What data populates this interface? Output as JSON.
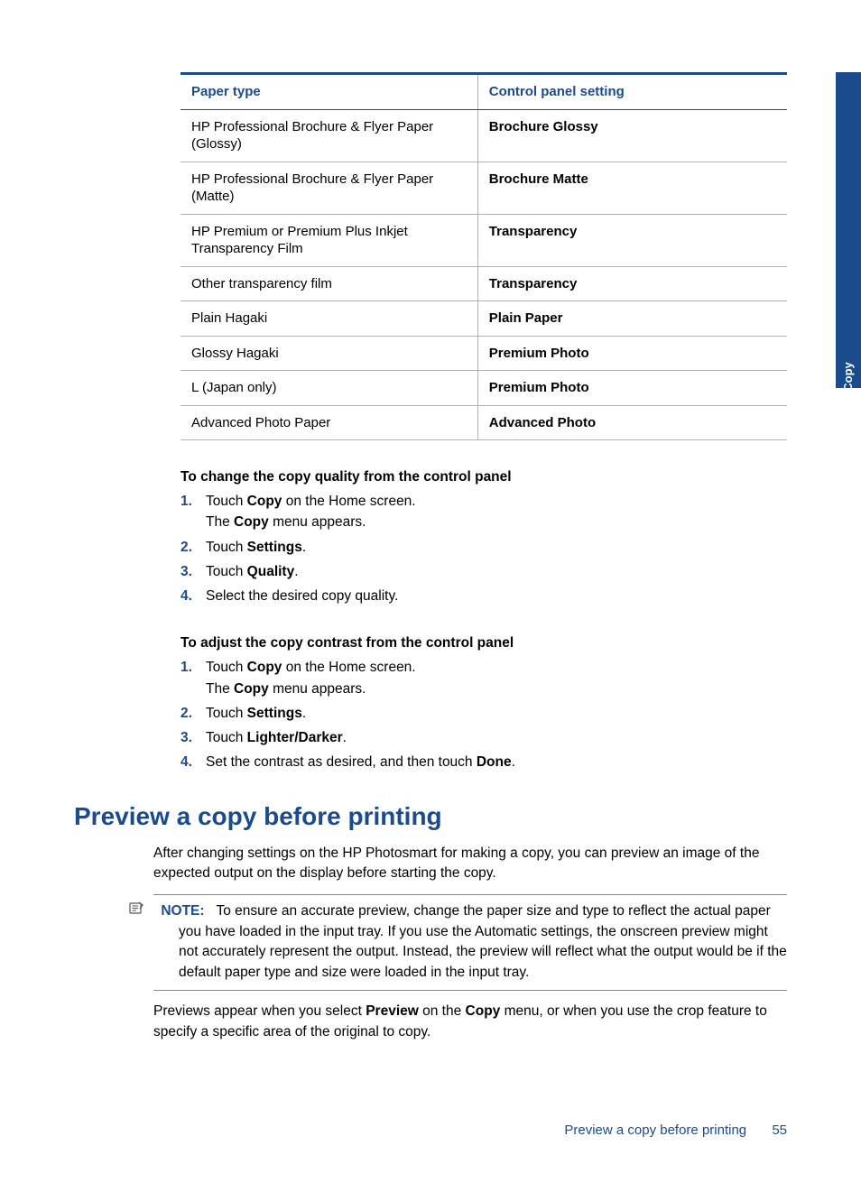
{
  "sidetab": {
    "label": "Copy"
  },
  "table": {
    "headers": [
      "Paper type",
      "Control panel setting"
    ],
    "rows": [
      [
        "HP Professional Brochure & Flyer Paper (Glossy)",
        "Brochure Glossy"
      ],
      [
        "HP Professional Brochure & Flyer Paper (Matte)",
        "Brochure Matte"
      ],
      [
        "HP Premium or Premium Plus Inkjet Transparency Film",
        "Transparency"
      ],
      [
        "Other transparency film",
        "Transparency"
      ],
      [
        "Plain Hagaki",
        "Plain Paper"
      ],
      [
        "Glossy Hagaki",
        "Premium Photo"
      ],
      [
        "L (Japan only)",
        "Premium Photo"
      ],
      [
        "Advanced Photo Paper",
        "Advanced Photo"
      ]
    ]
  },
  "section1": {
    "heading": "To change the copy quality from the control panel",
    "steps": {
      "s1": {
        "num": "1.",
        "prefix": "Touch ",
        "bold1": "Copy",
        "mid": " on the Home screen.",
        "line2a": "The ",
        "line2b": "Copy",
        "line2c": " menu appears."
      },
      "s2": {
        "num": "2.",
        "prefix": "Touch ",
        "bold1": "Settings",
        "suffix": "."
      },
      "s3": {
        "num": "3.",
        "prefix": "Touch ",
        "bold1": "Quality",
        "suffix": "."
      },
      "s4": {
        "num": "4.",
        "text": "Select the desired copy quality."
      }
    }
  },
  "section2": {
    "heading": "To adjust the copy contrast from the control panel",
    "steps": {
      "s1": {
        "num": "1.",
        "prefix": "Touch ",
        "bold1": "Copy",
        "mid": " on the Home screen.",
        "line2a": "The ",
        "line2b": "Copy",
        "line2c": " menu appears."
      },
      "s2": {
        "num": "2.",
        "prefix": "Touch ",
        "bold1": "Settings",
        "suffix": "."
      },
      "s3": {
        "num": "3.",
        "prefix": "Touch ",
        "bold1": "Lighter/Darker",
        "suffix": "."
      },
      "s4": {
        "num": "4.",
        "prefix": "Set the contrast as desired, and then touch ",
        "bold1": "Done",
        "suffix": "."
      }
    }
  },
  "preview": {
    "heading": "Preview a copy before printing",
    "para1": "After changing settings on the HP Photosmart for making a copy, you can preview an image of the expected output on the display before starting the copy.",
    "note": {
      "label": "NOTE:",
      "body": "To ensure an accurate preview, change the paper size and type to reflect the actual paper you have loaded in the input tray. If you use the Automatic settings, the onscreen preview might not accurately represent the output. Instead, the preview will reflect what the output would be if the default paper type and size were loaded in the input tray."
    },
    "para2": {
      "t1": "Previews appear when you select ",
      "b1": "Preview",
      "t2": " on the ",
      "b2": "Copy",
      "t3": " menu, or when you use the crop feature to specify a specific area of the original to copy."
    }
  },
  "footer": {
    "text": "Preview a copy before printing",
    "page": "55"
  }
}
